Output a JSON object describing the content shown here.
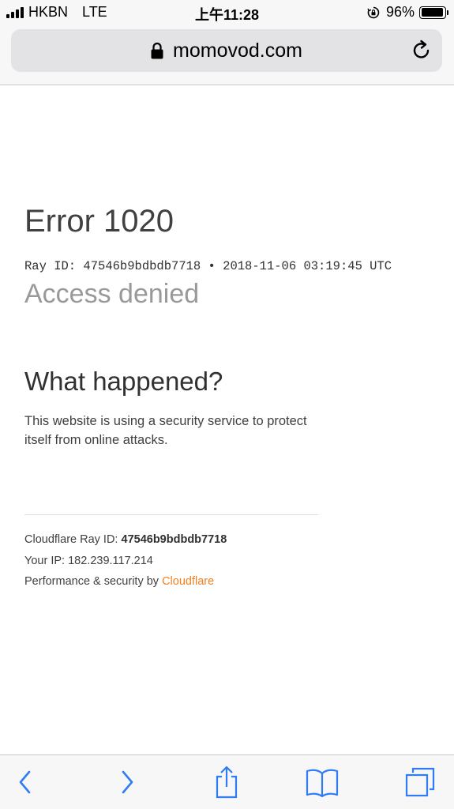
{
  "status_bar": {
    "carrier": "HKBN",
    "network": "LTE",
    "time": "上午11:28",
    "battery_percent": "96%",
    "battery_level": 0.96,
    "icons": [
      "signal-icon",
      "rotation-lock-icon",
      "battery-icon"
    ]
  },
  "address_bar": {
    "url": "momovod.com",
    "secure": true,
    "icons": [
      "padlock-icon",
      "reload-icon"
    ]
  },
  "page": {
    "error_title": "Error 1020",
    "ray_line": "Ray ID: 47546b9bdbdb7718 • 2018-11-06 03:19:45 UTC",
    "subtitle": "Access denied",
    "section_heading": "What happened?",
    "explanation": "This website is using a security service to protect itself from online attacks.",
    "footer": {
      "ray_label": "Cloudflare Ray ID:",
      "ray_value": "47546b9bdbdb7718",
      "ip_label": "Your IP:",
      "ip_value": "182.239.117.214",
      "perf_label": "Performance & security by",
      "perf_link": "Cloudflare"
    }
  },
  "toolbar": {
    "buttons": [
      "back-icon",
      "forward-icon",
      "share-icon",
      "bookmarks-icon",
      "tabs-icon"
    ]
  },
  "colors": {
    "accent": "#2f7cf6",
    "cloudflare_orange": "#f38020",
    "muted_text": "#999999",
    "text": "#404040"
  }
}
